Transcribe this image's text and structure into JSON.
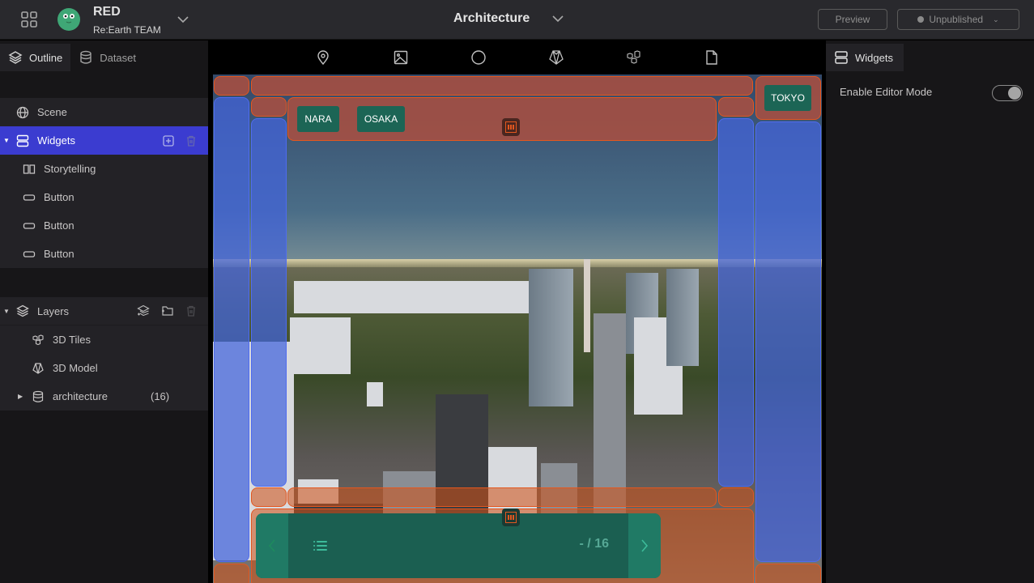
{
  "header": {
    "workspace_name": "RED",
    "workspace_team": "Re:Earth TEAM",
    "project_title": "Architecture",
    "preview_label": "Preview",
    "publish_status": "Unpublished"
  },
  "left_panel": {
    "tabs": [
      {
        "label": "Outline",
        "icon": "layers-icon",
        "active": true
      },
      {
        "label": "Dataset",
        "icon": "database-icon",
        "active": false
      }
    ],
    "scene": {
      "label": "Scene",
      "icon": "globe-icon"
    },
    "widgets": {
      "label": "Widgets",
      "icon": "widgets-icon",
      "selected": true,
      "expanded": true,
      "items": [
        {
          "label": "Storytelling",
          "icon": "book-icon"
        },
        {
          "label": "Button",
          "icon": "button-icon"
        },
        {
          "label": "Button",
          "icon": "button-icon"
        },
        {
          "label": "Button",
          "icon": "button-icon"
        }
      ]
    },
    "layers": {
      "label": "Layers",
      "icon": "layers-icon",
      "expanded": true,
      "items": [
        {
          "label": "3D Tiles",
          "icon": "tiles-icon"
        },
        {
          "label": "3D Model",
          "icon": "model-icon"
        },
        {
          "label": "architecture",
          "icon": "database-icon",
          "count": "(16)",
          "expandable": true
        }
      ]
    }
  },
  "toolbar": {
    "tools": [
      "marker-icon",
      "image-icon",
      "circle-icon",
      "model-icon",
      "tiles-icon",
      "file-icon"
    ]
  },
  "viewport": {
    "buttons": {
      "nara": "NARA",
      "osaka": "OSAKA",
      "tokyo": "TOKYO"
    },
    "storytelling": {
      "page_indicator": "- / 16"
    },
    "zone_colors": {
      "active_area": "#e3571f",
      "empty_area": "#4f6cf0",
      "widget_button": "#1c6555"
    }
  },
  "right_panel": {
    "tab_label": "Widgets",
    "enable_editor_mode_label": "Enable Editor Mode",
    "enable_editor_mode": true
  },
  "colors": {
    "selected_row": "#3b3cd0",
    "header_bg": "#29292d",
    "panel_bg": "#171618"
  }
}
